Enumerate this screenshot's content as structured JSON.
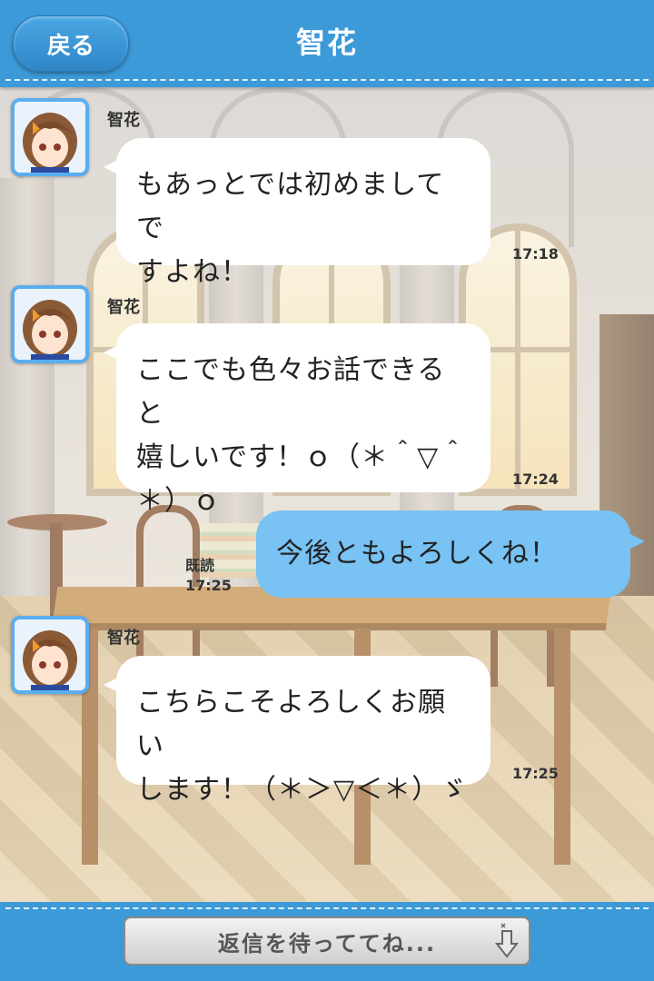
{
  "header": {
    "back_label": "戻る",
    "title": "智花"
  },
  "messages": [
    {
      "side": "left",
      "sender": "智花",
      "lines": [
        "もあっとでは初めましてで",
        "すよね！"
      ],
      "time": "17:18"
    },
    {
      "side": "left",
      "sender": "智花",
      "lines": [
        "ここでも色々お話できると",
        "嬉しいです！ｏ（＊＾▽＾",
        "＊）ｏ"
      ],
      "time": "17:24"
    },
    {
      "side": "right",
      "text": "今後ともよろしくね！",
      "read": "既読",
      "time": "17:25"
    },
    {
      "side": "left",
      "sender": "智花",
      "lines": [
        "こちらこそよろしくお願い",
        "します！（＊＞▽＜＊）ゞ"
      ],
      "time": "17:25"
    }
  ],
  "footer": {
    "reply_label": "返信を待っててね..."
  },
  "colors": {
    "header_bg": "#3c9ad8",
    "own_bubble": "#78c2f4",
    "other_bubble": "#ffffff",
    "avatar_border": "#5aaef0"
  },
  "icons": {
    "avatar": "character-avatar",
    "reply_hint": "down-arrow-icon"
  }
}
